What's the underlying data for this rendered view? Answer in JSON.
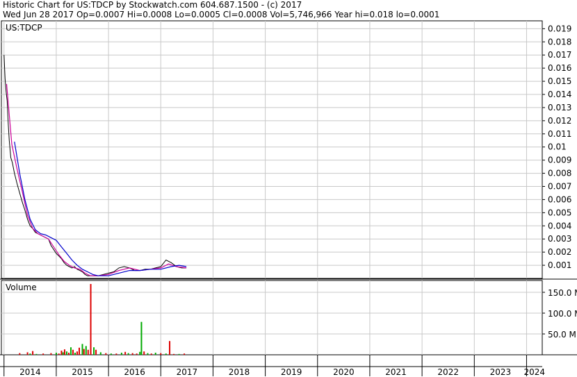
{
  "header": {
    "line1": "Historic Chart for US:TDCP by Stockwatch.com 604.687.1500 - (c) 2017",
    "line2": "Wed Jun 28 2017   Op=0.0007   Hi=0.0008   Lo=0.0005   Cl=0.0008   Vol=5,746,966   Year hi=0.018   lo=0.0001"
  },
  "chart_data": [
    {
      "type": "line",
      "title": "US:TDCP",
      "ylabel": "",
      "ylim": [
        0,
        0.0196
      ],
      "y_ticks": [
        "0.019",
        "0.018",
        "0.017",
        "0.016",
        "0.015",
        "0.014",
        "0.013",
        "0.012",
        "0.011",
        "0.01",
        "0.009",
        "0.008",
        "0.007",
        "0.006",
        "0.005",
        "0.004",
        "0.003",
        "0.002",
        "0.001"
      ],
      "x_labels": [
        "2014",
        "2015",
        "2016",
        "2017",
        "2018",
        "2019",
        "2020",
        "2021",
        "2022",
        "2023",
        "2024"
      ],
      "grid": true,
      "colors": {
        "price": "#000000",
        "ma_short": "#cc0099",
        "ma_long": "#0000cc"
      },
      "series": [
        {
          "role": "price",
          "x": [
            2014.0,
            2014.02,
            2014.04,
            2014.06,
            2014.08,
            2014.1,
            2014.13,
            2014.16,
            2014.2,
            2014.25,
            2014.3,
            2014.35,
            2014.4,
            2014.45,
            2014.5,
            2014.55,
            2014.6,
            2014.65,
            2014.7,
            2014.75,
            2014.8,
            2014.85,
            2014.9,
            2014.95,
            2015.0,
            2015.05,
            2015.1,
            2015.15,
            2015.2,
            2015.25,
            2015.3,
            2015.35,
            2015.4,
            2015.45,
            2015.5,
            2015.55,
            2015.6,
            2015.65,
            2015.7,
            2015.8,
            2015.9,
            2016.0,
            2016.1,
            2016.2,
            2016.3,
            2016.4,
            2016.5,
            2016.6,
            2016.7,
            2016.8,
            2016.9,
            2017.0,
            2017.1,
            2017.2,
            2017.3,
            2017.4,
            2017.49
          ],
          "values": [
            0.017,
            0.0152,
            0.0142,
            0.0135,
            0.0118,
            0.0105,
            0.0092,
            0.0088,
            0.008,
            0.0072,
            0.0065,
            0.0058,
            0.0052,
            0.0045,
            0.004,
            0.0038,
            0.0035,
            0.0034,
            0.0033,
            0.0032,
            0.0031,
            0.003,
            0.0025,
            0.0022,
            0.0019,
            0.0017,
            0.0015,
            0.0012,
            0.001,
            0.0009,
            0.0008,
            0.0009,
            0.0007,
            0.0006,
            0.0005,
            0.0003,
            0.0002,
            0.0002,
            0.0002,
            0.0002,
            0.0003,
            0.0004,
            0.0005,
            0.0008,
            0.0009,
            0.0008,
            0.0006,
            0.0006,
            0.0007,
            0.0007,
            0.0008,
            0.0009,
            0.0014,
            0.0012,
            0.0009,
            0.0008,
            0.0008
          ]
        },
        {
          "role": "ma_short",
          "x": [
            2014.05,
            2014.15,
            2014.25,
            2014.35,
            2014.45,
            2014.55,
            2014.65,
            2014.75,
            2014.85,
            2014.95,
            2015.05,
            2015.15,
            2015.25,
            2015.35,
            2015.45,
            2015.55,
            2015.65,
            2015.8,
            2016.0,
            2016.2,
            2016.4,
            2016.6,
            2016.8,
            2017.0,
            2017.15,
            2017.3,
            2017.49
          ],
          "values": [
            0.0148,
            0.0102,
            0.0083,
            0.0066,
            0.0048,
            0.0038,
            0.0034,
            0.0032,
            0.003,
            0.0024,
            0.0018,
            0.0013,
            0.001,
            0.0008,
            0.0007,
            0.0004,
            0.0002,
            0.0002,
            0.0003,
            0.0006,
            0.0008,
            0.0006,
            0.0007,
            0.0008,
            0.0011,
            0.0009,
            0.0008
          ]
        },
        {
          "role": "ma_long",
          "x": [
            2014.2,
            2014.3,
            2014.4,
            2014.5,
            2014.6,
            2014.7,
            2014.8,
            2014.9,
            2015.0,
            2015.1,
            2015.2,
            2015.3,
            2015.4,
            2015.5,
            2015.6,
            2015.7,
            2015.8,
            2016.0,
            2016.2,
            2016.4,
            2016.6,
            2016.8,
            2017.0,
            2017.2,
            2017.35,
            2017.49
          ],
          "values": [
            0.0104,
            0.008,
            0.006,
            0.0045,
            0.0037,
            0.0034,
            0.0033,
            0.0031,
            0.0029,
            0.0024,
            0.0019,
            0.0014,
            0.001,
            0.0007,
            0.0005,
            0.0003,
            0.0002,
            0.0002,
            0.0004,
            0.0006,
            0.0006,
            0.0007,
            0.0007,
            0.0009,
            0.001,
            0.0009
          ]
        }
      ]
    },
    {
      "type": "bar",
      "title": "Volume",
      "ylabel": "",
      "ylim": [
        0,
        175
      ],
      "y_ticks": [
        "150.0 M",
        "100.0 M",
        "50.0 M"
      ],
      "x_labels": [
        "2014",
        "2015",
        "2016",
        "2017",
        "2018",
        "2019",
        "2020",
        "2021",
        "2022",
        "2023",
        "2024"
      ],
      "grid": true,
      "colors": {
        "up": "#00aa00",
        "down": "#dd0000"
      },
      "bars": [
        {
          "x": 2014.3,
          "value": 4,
          "dir": "down"
        },
        {
          "x": 2014.45,
          "value": 6,
          "dir": "down"
        },
        {
          "x": 2014.5,
          "value": 3,
          "dir": "up"
        },
        {
          "x": 2014.55,
          "value": 9,
          "dir": "down"
        },
        {
          "x": 2014.62,
          "value": 2,
          "dir": "up"
        },
        {
          "x": 2014.75,
          "value": 3,
          "dir": "down"
        },
        {
          "x": 2014.9,
          "value": 4,
          "dir": "down"
        },
        {
          "x": 2015.0,
          "value": 5,
          "dir": "up"
        },
        {
          "x": 2015.05,
          "value": 3,
          "dir": "down"
        },
        {
          "x": 2015.1,
          "value": 10,
          "dir": "down"
        },
        {
          "x": 2015.13,
          "value": 6,
          "dir": "up"
        },
        {
          "x": 2015.16,
          "value": 13,
          "dir": "down"
        },
        {
          "x": 2015.2,
          "value": 8,
          "dir": "up"
        },
        {
          "x": 2015.24,
          "value": 5,
          "dir": "down"
        },
        {
          "x": 2015.28,
          "value": 18,
          "dir": "up"
        },
        {
          "x": 2015.32,
          "value": 12,
          "dir": "down"
        },
        {
          "x": 2015.36,
          "value": 5,
          "dir": "up"
        },
        {
          "x": 2015.4,
          "value": 8,
          "dir": "down"
        },
        {
          "x": 2015.44,
          "value": 17,
          "dir": "down"
        },
        {
          "x": 2015.5,
          "value": 26,
          "dir": "up"
        },
        {
          "x": 2015.53,
          "value": 14,
          "dir": "down"
        },
        {
          "x": 2015.57,
          "value": 21,
          "dir": "up"
        },
        {
          "x": 2015.61,
          "value": 12,
          "dir": "down"
        },
        {
          "x": 2015.66,
          "value": 170,
          "dir": "down"
        },
        {
          "x": 2015.72,
          "value": 18,
          "dir": "up"
        },
        {
          "x": 2015.76,
          "value": 12,
          "dir": "down"
        },
        {
          "x": 2015.85,
          "value": 6,
          "dir": "up"
        },
        {
          "x": 2015.95,
          "value": 4,
          "dir": "down"
        },
        {
          "x": 2016.05,
          "value": 3,
          "dir": "up"
        },
        {
          "x": 2016.15,
          "value": 3,
          "dir": "down"
        },
        {
          "x": 2016.25,
          "value": 5,
          "dir": "up"
        },
        {
          "x": 2016.32,
          "value": 7,
          "dir": "down"
        },
        {
          "x": 2016.38,
          "value": 4,
          "dir": "up"
        },
        {
          "x": 2016.46,
          "value": 4,
          "dir": "down"
        },
        {
          "x": 2016.54,
          "value": 3,
          "dir": "down"
        },
        {
          "x": 2016.6,
          "value": 7,
          "dir": "up"
        },
        {
          "x": 2016.63,
          "value": 79,
          "dir": "up"
        },
        {
          "x": 2016.68,
          "value": 8,
          "dir": "down"
        },
        {
          "x": 2016.75,
          "value": 4,
          "dir": "up"
        },
        {
          "x": 2016.82,
          "value": 3,
          "dir": "down"
        },
        {
          "x": 2016.9,
          "value": 5,
          "dir": "up"
        },
        {
          "x": 2017.0,
          "value": 4,
          "dir": "down"
        },
        {
          "x": 2017.1,
          "value": 3,
          "dir": "up"
        },
        {
          "x": 2017.17,
          "value": 33,
          "dir": "down"
        },
        {
          "x": 2017.25,
          "value": 2,
          "dir": "down"
        },
        {
          "x": 2017.35,
          "value": 2,
          "dir": "up"
        },
        {
          "x": 2017.45,
          "value": 3,
          "dir": "down"
        }
      ]
    }
  ]
}
